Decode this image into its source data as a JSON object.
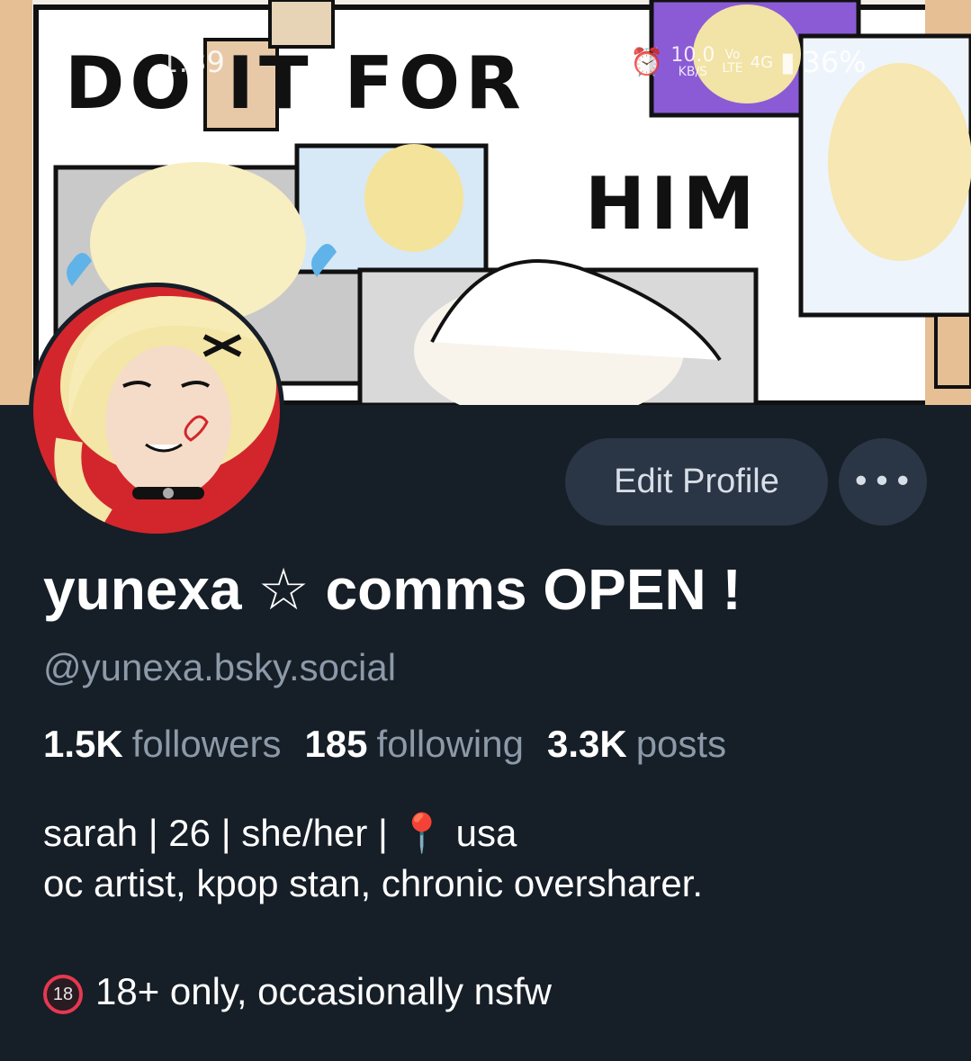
{
  "status_bar": {
    "time": "1:39",
    "net_speed_value": "10.0",
    "net_speed_unit": "KB/S",
    "volte_top": "Vo",
    "volte_bottom": "LTE",
    "network": "4G",
    "battery": "36%",
    "icons": [
      "alarm-icon",
      "volte-icon",
      "signal-icon"
    ]
  },
  "banner": {
    "line1": "DO IT FOR",
    "line2": "HIM"
  },
  "profile": {
    "display_name": "yunexa ☆ comms OPEN !",
    "handle": "@yunexa.bsky.social",
    "stats": {
      "followers_count": "1.5K",
      "followers_label": "followers",
      "following_count": "185",
      "following_label": "following",
      "posts_count": "3.3K",
      "posts_label": "posts"
    },
    "bio": {
      "line1": "sarah | 26 | she/her | ",
      "pin_icon": "📍",
      "line1_end": " usa",
      "line2": "oc artist, kpop stan, chronic oversharer.",
      "age_badge_text": "18",
      "line3": "18+ only, occasionally nsfw"
    }
  },
  "actions": {
    "edit_profile_label": "Edit Profile",
    "more_label": "•••"
  },
  "colors": {
    "background": "#161e27",
    "button_bg": "#2a3645",
    "muted_text": "#8c99a8",
    "accent_red": "#e53950"
  }
}
